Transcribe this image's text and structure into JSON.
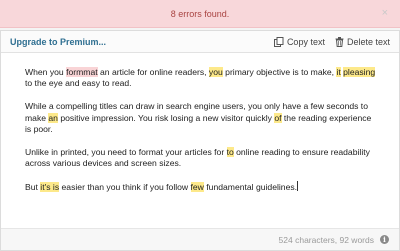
{
  "alert": {
    "text": "8 errors found.",
    "close_glyph": "×"
  },
  "toolbar": {
    "upgrade_label": "Upgrade to Premium...",
    "copy_label": "Copy text",
    "delete_label": "Delete text"
  },
  "editor": {
    "paragraphs": [
      [
        {
          "t": "When you "
        },
        {
          "t": "formmat",
          "k": "err"
        },
        {
          "t": " an article for online readers, "
        },
        {
          "t": "you",
          "k": "hl"
        },
        {
          "t": " primary objective is to make, "
        },
        {
          "t": "it",
          "k": "hl"
        },
        {
          "t": " "
        },
        {
          "t": "pleasing",
          "k": "hl"
        },
        {
          "t": " to the eye and easy to read."
        }
      ],
      [
        {
          "t": "While a compelling titles can draw in search engine users, you only have a few seconds to make "
        },
        {
          "t": "an",
          "k": "hl"
        },
        {
          "t": " positive impression. You risk losing a new visitor quickly "
        },
        {
          "t": "of",
          "k": "hl"
        },
        {
          "t": " the reading experience is poor."
        }
      ],
      [
        {
          "t": "Unlike in printed, you need to format your articles for "
        },
        {
          "t": "to",
          "k": "hl"
        },
        {
          "t": " online reading to ensure readability across various devices and screen sizes."
        }
      ],
      [
        {
          "t": "But "
        },
        {
          "t": "it's is",
          "k": "hl"
        },
        {
          "t": " easier than you think if you follow "
        },
        {
          "t": "few",
          "k": "hl"
        },
        {
          "t": " fundamental guidelines."
        }
      ]
    ]
  },
  "footer": {
    "stats": "524 characters, 92 words",
    "info_glyph": "i"
  }
}
